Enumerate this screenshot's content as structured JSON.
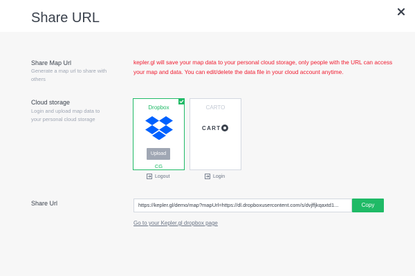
{
  "modal": {
    "title": "Share URL",
    "close_icon": "close-icon"
  },
  "share_map": {
    "label": "Share Map Url",
    "description": "Generate a map url to share with others",
    "warning": "kepler.gl will save your map data to your personal cloud storage, only people with the URL can access your map and data. You can edit/delete the data file in your cloud account anytime."
  },
  "cloud_storage": {
    "label": "Cloud storage",
    "description": "Login and upload map data to your personal cloud storage",
    "providers": [
      {
        "name": "Dropbox",
        "selected": true,
        "icon": "dropbox-icon",
        "upload_label": "Upload",
        "user": "CG",
        "action_label": "Logout",
        "action_icon": "logout-icon"
      },
      {
        "name": "CARTO",
        "selected": false,
        "logo_text": "CART",
        "action_label": "Login",
        "action_icon": "login-icon"
      }
    ]
  },
  "share_url": {
    "label": "Share Url",
    "value": "https://kepler.gl/demo/map?mapUrl=https://dl.dropboxusercontent.com/s/dvjffjkqaxtd1...",
    "copy_label": "Copy",
    "link_text": "Go to your Kepler.gl dropbox page"
  },
  "colors": {
    "accent_green": "#1fba66",
    "warning_red": "#f0192d",
    "text_primary": "#3a414c",
    "text_secondary": "#a0a7b4"
  }
}
